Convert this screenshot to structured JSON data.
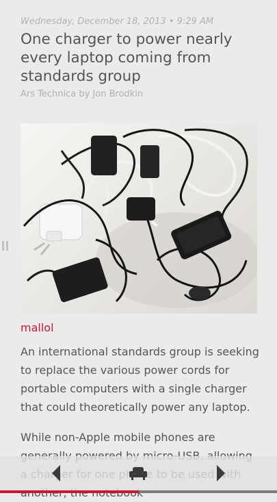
{
  "article": {
    "dateline": "Wednesday, December 18, 2013 • 9:29 AM",
    "headline": "One charger to power nearly every laptop coming from standards group",
    "byline": "Ars Technica by Jon Brodkin",
    "source_tag": "mallol",
    "paragraphs": [
      "An international standards group is seeking to replace the various power cords for portable computers with a single charger that could theoretically power any laptop.",
      "While non-Apple mobile phones are generally powered by micro-USB, allowing a charger for one phone to be used with another, the notebook"
    ]
  },
  "toolbar": {
    "prev_icon": "chevron-left-icon",
    "reader_icon": "armchair-icon",
    "next_icon": "chevron-right-icon"
  },
  "reading_progress": 0.5,
  "colors": {
    "accent": "#c91830",
    "background": "#ebebeb",
    "text": "#555555",
    "muted": "#b0b0b0"
  }
}
